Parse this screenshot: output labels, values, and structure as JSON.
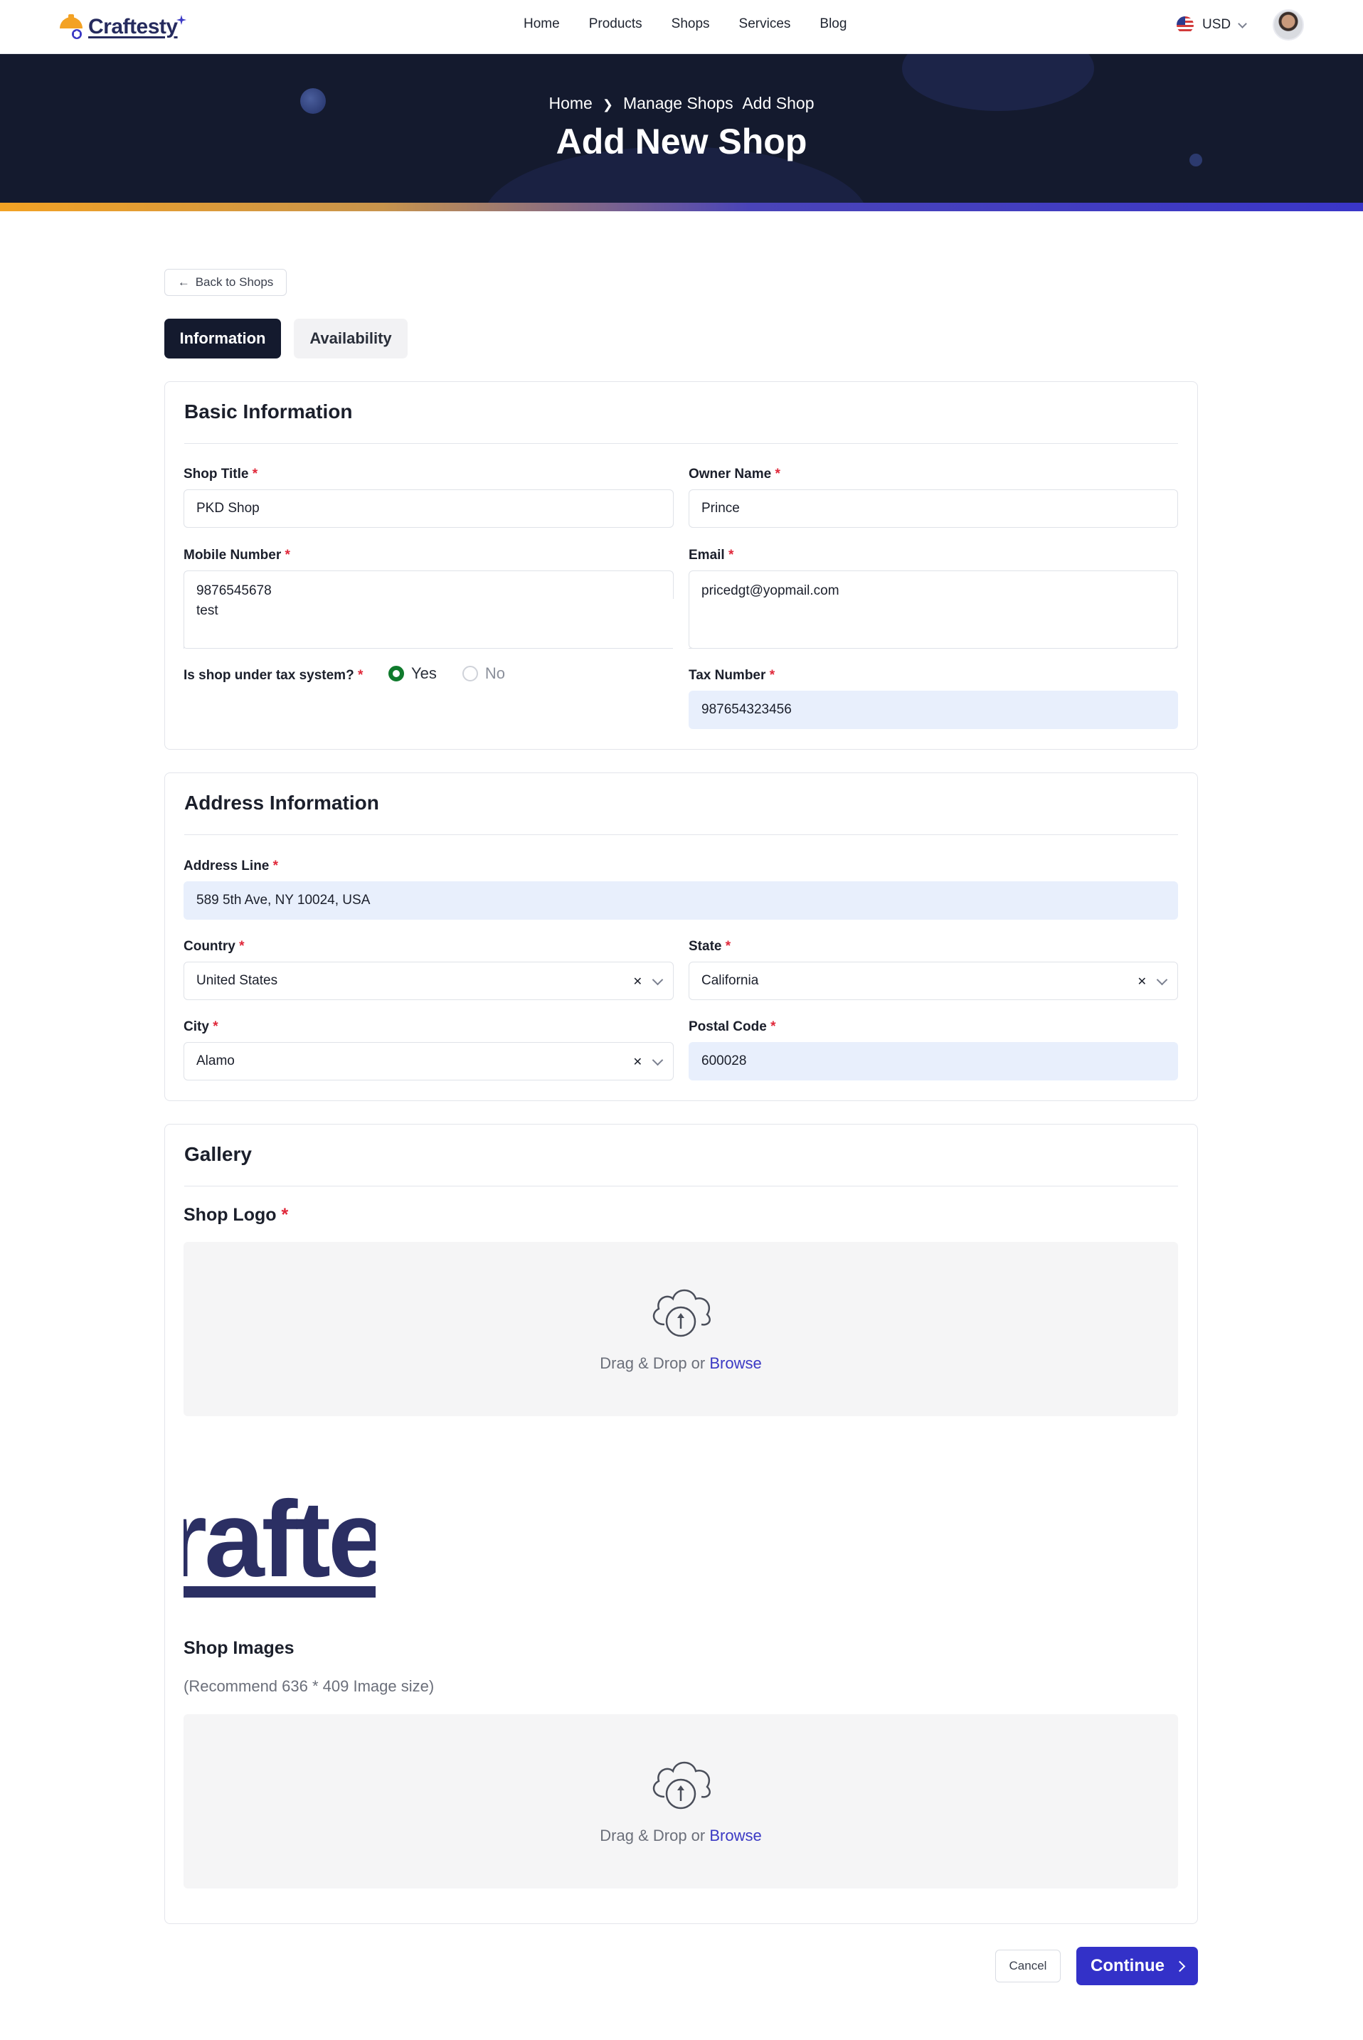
{
  "brand": {
    "name": "Craftesty"
  },
  "nav": {
    "links": [
      "Home",
      "Products",
      "Shops",
      "Services",
      "Blog"
    ],
    "currency": "USD"
  },
  "hero": {
    "breadcrumb": [
      "Home",
      "Manage Shops",
      "Add Shop"
    ],
    "title": "Add New Shop"
  },
  "back_label": "Back to Shops",
  "tabs": [
    {
      "label": "Information",
      "active": true
    },
    {
      "label": "Availability",
      "active": false
    }
  ],
  "basic": {
    "title": "Basic Information",
    "shop_title": {
      "label": "Shop Title",
      "value": "PKD Shop"
    },
    "owner_name": {
      "label": "Owner Name",
      "value": "Prince"
    },
    "mobile": {
      "label": "Mobile Number",
      "value_line1": "9876545678",
      "value_line2": "test"
    },
    "email": {
      "label": "Email",
      "value": "pricedgt@yopmail.com"
    },
    "tax_question": {
      "label": "Is shop under tax system?",
      "yes": "Yes",
      "no": "No",
      "selected": "Yes"
    },
    "tax_number": {
      "label": "Tax Number",
      "value": "987654323456"
    }
  },
  "address": {
    "title": "Address Information",
    "line": {
      "label": "Address Line",
      "value": "589 5th Ave, NY 10024, USA"
    },
    "country": {
      "label": "Country",
      "value": "United States"
    },
    "state": {
      "label": "State",
      "value": "California"
    },
    "city": {
      "label": "City",
      "value": "Alamo"
    },
    "postal": {
      "label": "Postal Code",
      "value": "600028"
    }
  },
  "gallery": {
    "title": "Gallery",
    "logo_label": "Shop Logo",
    "logo_preview_text": "rafte",
    "images_label": "Shop Images",
    "images_hint": "(Recommend 636 * 409 Image size)",
    "drop_text": "Drag & Drop or ",
    "browse_text": "Browse"
  },
  "actions": {
    "cancel": "Cancel",
    "continue": "Continue"
  },
  "colors": {
    "primary": "#3331c8",
    "dark": "#141a2e",
    "required": "#e0283a",
    "radio_on": "#0f7a2c",
    "accent_orange": "#f3a224"
  }
}
